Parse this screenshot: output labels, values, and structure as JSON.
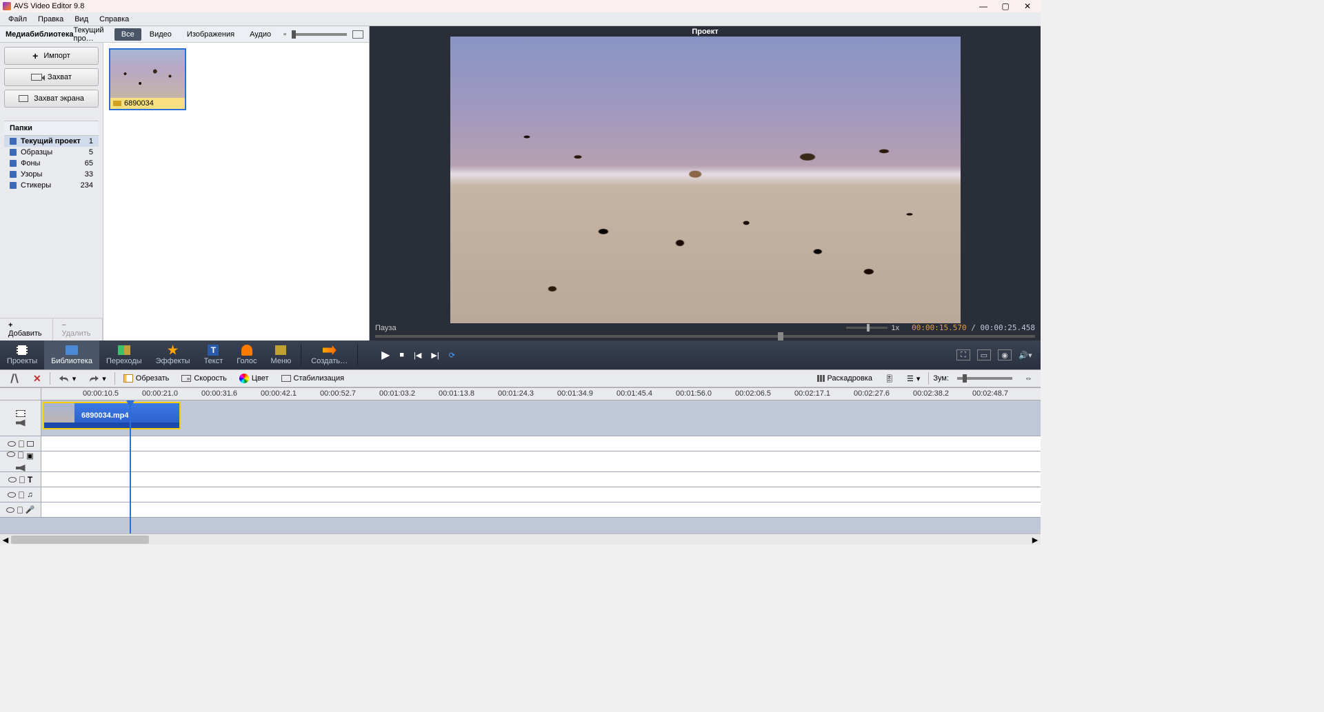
{
  "titlebar": {
    "title": "AVS Video Editor 9.8"
  },
  "menubar": [
    "Файл",
    "Правка",
    "Вид",
    "Справка"
  ],
  "media_library": {
    "header": "Медиабиблиотека",
    "current_label": "Текущий про…",
    "tabs": {
      "all": "Все",
      "video": "Видео",
      "images": "Изображения",
      "audio": "Аудио"
    },
    "buttons": {
      "import": "Импорт",
      "capture": "Захват",
      "screen_capture": "Захват экрана"
    },
    "thumb": {
      "name": "6890034"
    },
    "folders_header": "Папки",
    "folders": [
      {
        "name": "Текущий проект",
        "count": "1",
        "selected": true
      },
      {
        "name": "Образцы",
        "count": "5"
      },
      {
        "name": "Фоны",
        "count": "65"
      },
      {
        "name": "Узоры",
        "count": "33"
      },
      {
        "name": "Стикеры",
        "count": "234"
      }
    ],
    "footer": {
      "add": "Добавить",
      "delete": "Удалить"
    }
  },
  "preview": {
    "title": "Проект",
    "status": "Пауза",
    "speed": "1x",
    "current": "00:00:15.570",
    "total": "00:00:25.458"
  },
  "ribbon": {
    "items": [
      {
        "key": "projects",
        "label": "Проекты"
      },
      {
        "key": "library",
        "label": "Библиотека",
        "active": true
      },
      {
        "key": "transitions",
        "label": "Переходы"
      },
      {
        "key": "effects",
        "label": "Эффекты"
      },
      {
        "key": "text",
        "label": "Текст"
      },
      {
        "key": "voice",
        "label": "Голос"
      },
      {
        "key": "menu",
        "label": "Меню"
      },
      {
        "key": "create",
        "label": "Создать…"
      }
    ]
  },
  "timeline_toolbar": {
    "trim": "Обрезать",
    "speed": "Скорость",
    "color": "Цвет",
    "stabilize": "Стабилизация",
    "storyboard": "Раскадровка",
    "zoom": "Зум:"
  },
  "ruler_ticks": [
    "00:00:10.5",
    "00:00:21.0",
    "00:00:31.6",
    "00:00:42.1",
    "00:00:52.7",
    "00:01:03.2",
    "00:01:13.8",
    "00:01:24.3",
    "00:01:34.9",
    "00:01:45.4",
    "00:01:56.0",
    "00:02:06.5",
    "00:02:17.1",
    "00:02:27.6",
    "00:02:38.2",
    "00:02:48.7"
  ],
  "clip": {
    "label": "6890034.mp4"
  }
}
